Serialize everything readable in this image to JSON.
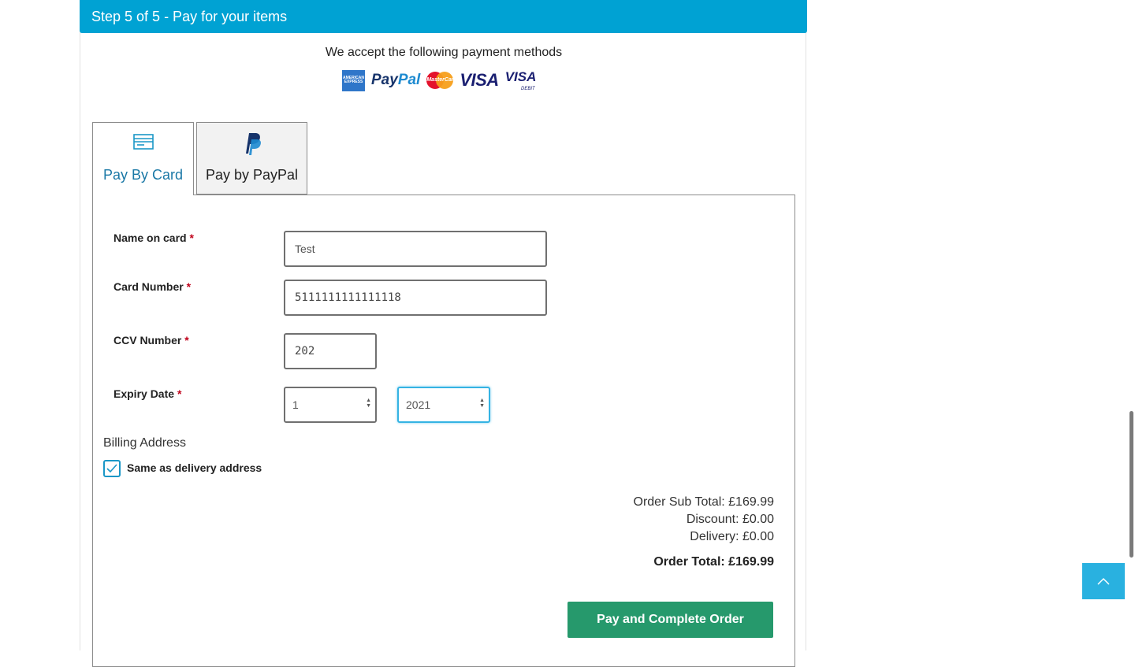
{
  "header": {
    "title": "Step 5 of 5 - Pay for your items"
  },
  "payment_methods": {
    "intro": "We accept the following payment methods",
    "logos": [
      {
        "name": "amex-logo",
        "text": "AMERICAN EXPRESS"
      },
      {
        "name": "paypal-logo",
        "text_pay": "Pay",
        "text_pal": "Pal"
      },
      {
        "name": "mastercard-logo",
        "text": "MasterCard"
      },
      {
        "name": "visa-logo",
        "text": "VISA"
      },
      {
        "name": "visa-debit-logo",
        "text": "VISA",
        "sub": "DEBIT"
      }
    ]
  },
  "tabs": [
    {
      "label": "Pay By Card",
      "icon": "credit-card-icon",
      "active": true
    },
    {
      "label": "Pay by PayPal",
      "icon": "paypal-icon",
      "active": false
    }
  ],
  "form": {
    "required_mark": "*",
    "name_on_card": {
      "label": "Name on card",
      "value": "Test"
    },
    "card_number": {
      "label": "Card Number",
      "value": "5111111111111118"
    },
    "ccv": {
      "label": "CCV Number",
      "value": "202"
    },
    "expiry": {
      "label": "Expiry Date",
      "month": "1",
      "year": "2021"
    },
    "billing": {
      "heading": "Billing Address",
      "same_as_delivery": {
        "label": "Same as delivery address",
        "checked": true
      }
    }
  },
  "totals": {
    "sub_total": "Order Sub Total: £169.99",
    "discount": "Discount: £0.00",
    "delivery": "Delivery: £0.00",
    "order_total": "Order Total: £169.99"
  },
  "actions": {
    "pay_button": "Pay and Complete Order"
  },
  "colors": {
    "header_bg": "#00a2d3",
    "pay_button_bg": "#26996c",
    "scroll_top_bg": "#29b1e0",
    "tab_active_text": "#1a78a6"
  },
  "scroll_top": {
    "icon": "chevron-up-icon"
  }
}
